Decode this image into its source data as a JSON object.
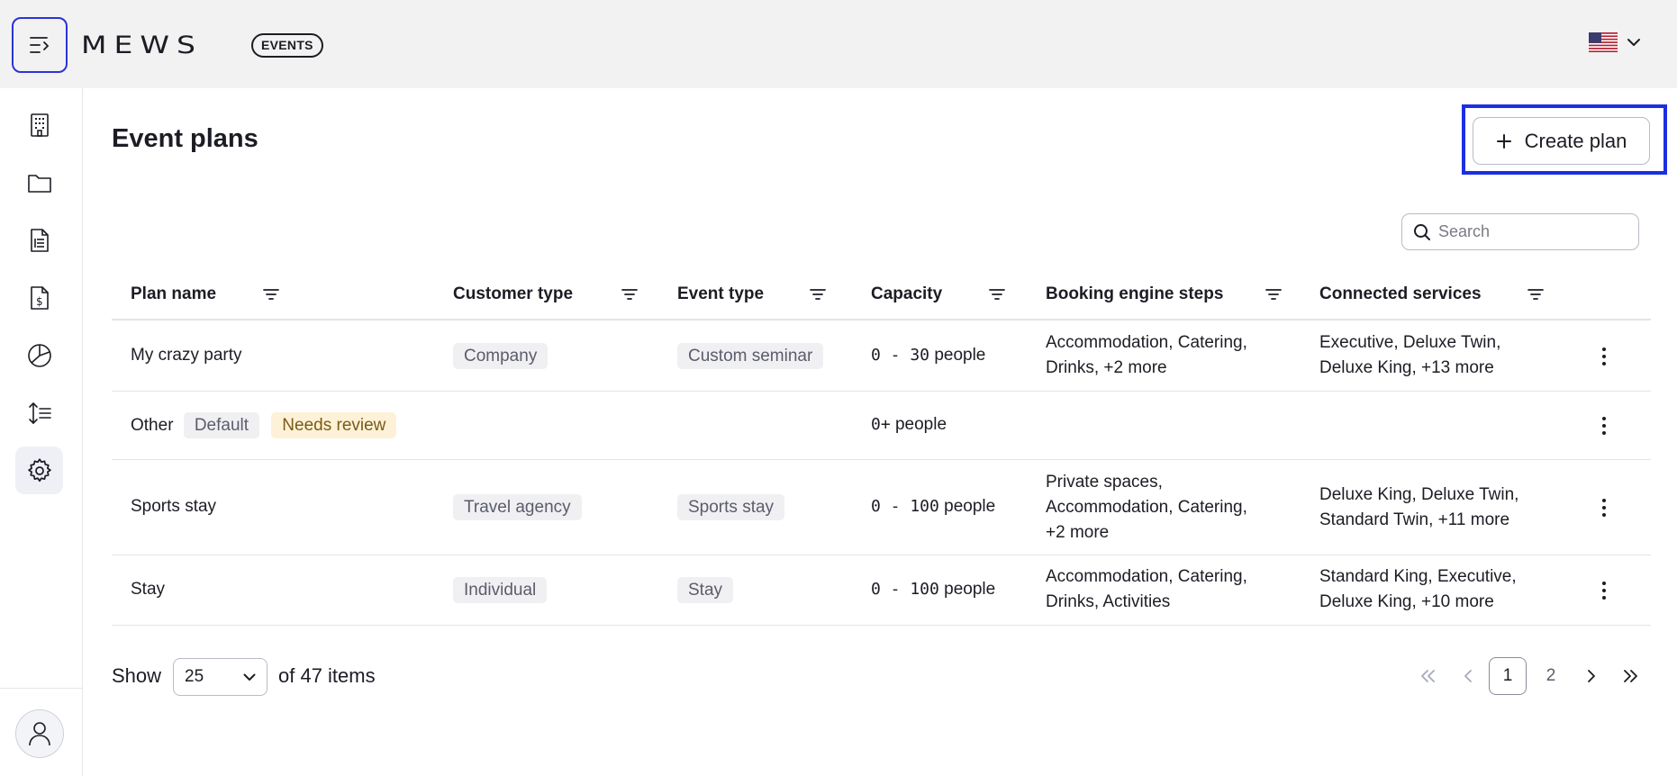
{
  "header": {
    "logo": "MEWS",
    "product_badge": "EVENTS",
    "language_icon": "us-flag-icon"
  },
  "sidebar": {
    "items": [
      {
        "icon": "building-icon"
      },
      {
        "icon": "folder-icon"
      },
      {
        "icon": "document-list-icon"
      },
      {
        "icon": "invoice-dollar-icon"
      },
      {
        "icon": "pie-chart-icon"
      },
      {
        "icon": "sort-list-icon"
      },
      {
        "icon": "gear-icon",
        "active": true
      }
    ],
    "user_icon": "user-icon"
  },
  "page": {
    "title": "Event plans",
    "create_button": "Create plan",
    "search_placeholder": "Search"
  },
  "table": {
    "columns": [
      "Plan name",
      "Customer type",
      "Event type",
      "Capacity",
      "Booking engine steps",
      "Connected services"
    ],
    "rows": [
      {
        "name": "My crazy party",
        "badges": [],
        "customer_type": "Company",
        "event_type": "Custom seminar",
        "capacity_num": "0 - 30",
        "capacity_unit": "people",
        "steps": [
          "Accommodation, Catering,",
          "Drinks, +2 more"
        ],
        "services": [
          "Executive, Deluxe Twin,",
          "Deluxe King, +13 more"
        ]
      },
      {
        "name": "Other",
        "badges": [
          "Default",
          "Needs review"
        ],
        "customer_type": "",
        "event_type": "",
        "capacity_num": "0+",
        "capacity_unit": "people",
        "steps": [],
        "services": []
      },
      {
        "name": "Sports stay",
        "badges": [],
        "customer_type": "Travel agency",
        "event_type": "Sports stay",
        "capacity_num": "0 - 100",
        "capacity_unit": "people",
        "steps": [
          "Private spaces,",
          "Accommodation, Catering,",
          "+2 more"
        ],
        "services": [
          "Deluxe King, Deluxe Twin,",
          "Standard Twin, +11 more"
        ]
      },
      {
        "name": "Stay",
        "badges": [],
        "customer_type": "Individual",
        "event_type": "Stay",
        "capacity_num": "0 - 100",
        "capacity_unit": "people",
        "steps": [
          "Accommodation, Catering,",
          "Drinks, Activities"
        ],
        "services": [
          "Standard King, Executive,",
          "Deluxe King, +10 more"
        ]
      }
    ]
  },
  "footer": {
    "show_label": "Show",
    "page_size": "25",
    "items_label": "of 47 items",
    "pages": [
      "1",
      "2"
    ],
    "current_page": "1"
  },
  "colors": {
    "focus_outline": "#1a2fe0",
    "menu_button_border": "#2b33d8",
    "tag_bg": "#f0f0f3",
    "warning_tag_bg": "#fdf2d7"
  }
}
